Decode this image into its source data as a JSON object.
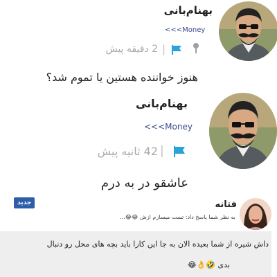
{
  "comments": [
    {
      "author": "بهنام‌بانی",
      "tag": "Money>>>",
      "time": "2 دقیقه پیش",
      "text": "هنوز خواننده هستین یا تموم شد؟"
    },
    {
      "author": "بهنام‌بانی",
      "tag": "Money>>>",
      "time": "42 ثانیه پیش",
      "text": "عاشقو در به درم"
    },
    {
      "author": "فتانه",
      "badge": "جدید",
      "reply_note": "به نظر شما پاسخ داد: تست میسازم ازش 😂😂...",
      "text": "داش شیره از شما بعیده الان به جا این کارا باید بچه های محل رو دنبال",
      "text_cont": "بدی 🤣👌😂"
    }
  ],
  "colors": {
    "tag": "#3a4a8a",
    "flag": "#29a3d8",
    "badge": "#2f5ea8",
    "meta": "#a9a9a9"
  },
  "icons": [
    "flag-icon",
    "pin-icon"
  ]
}
